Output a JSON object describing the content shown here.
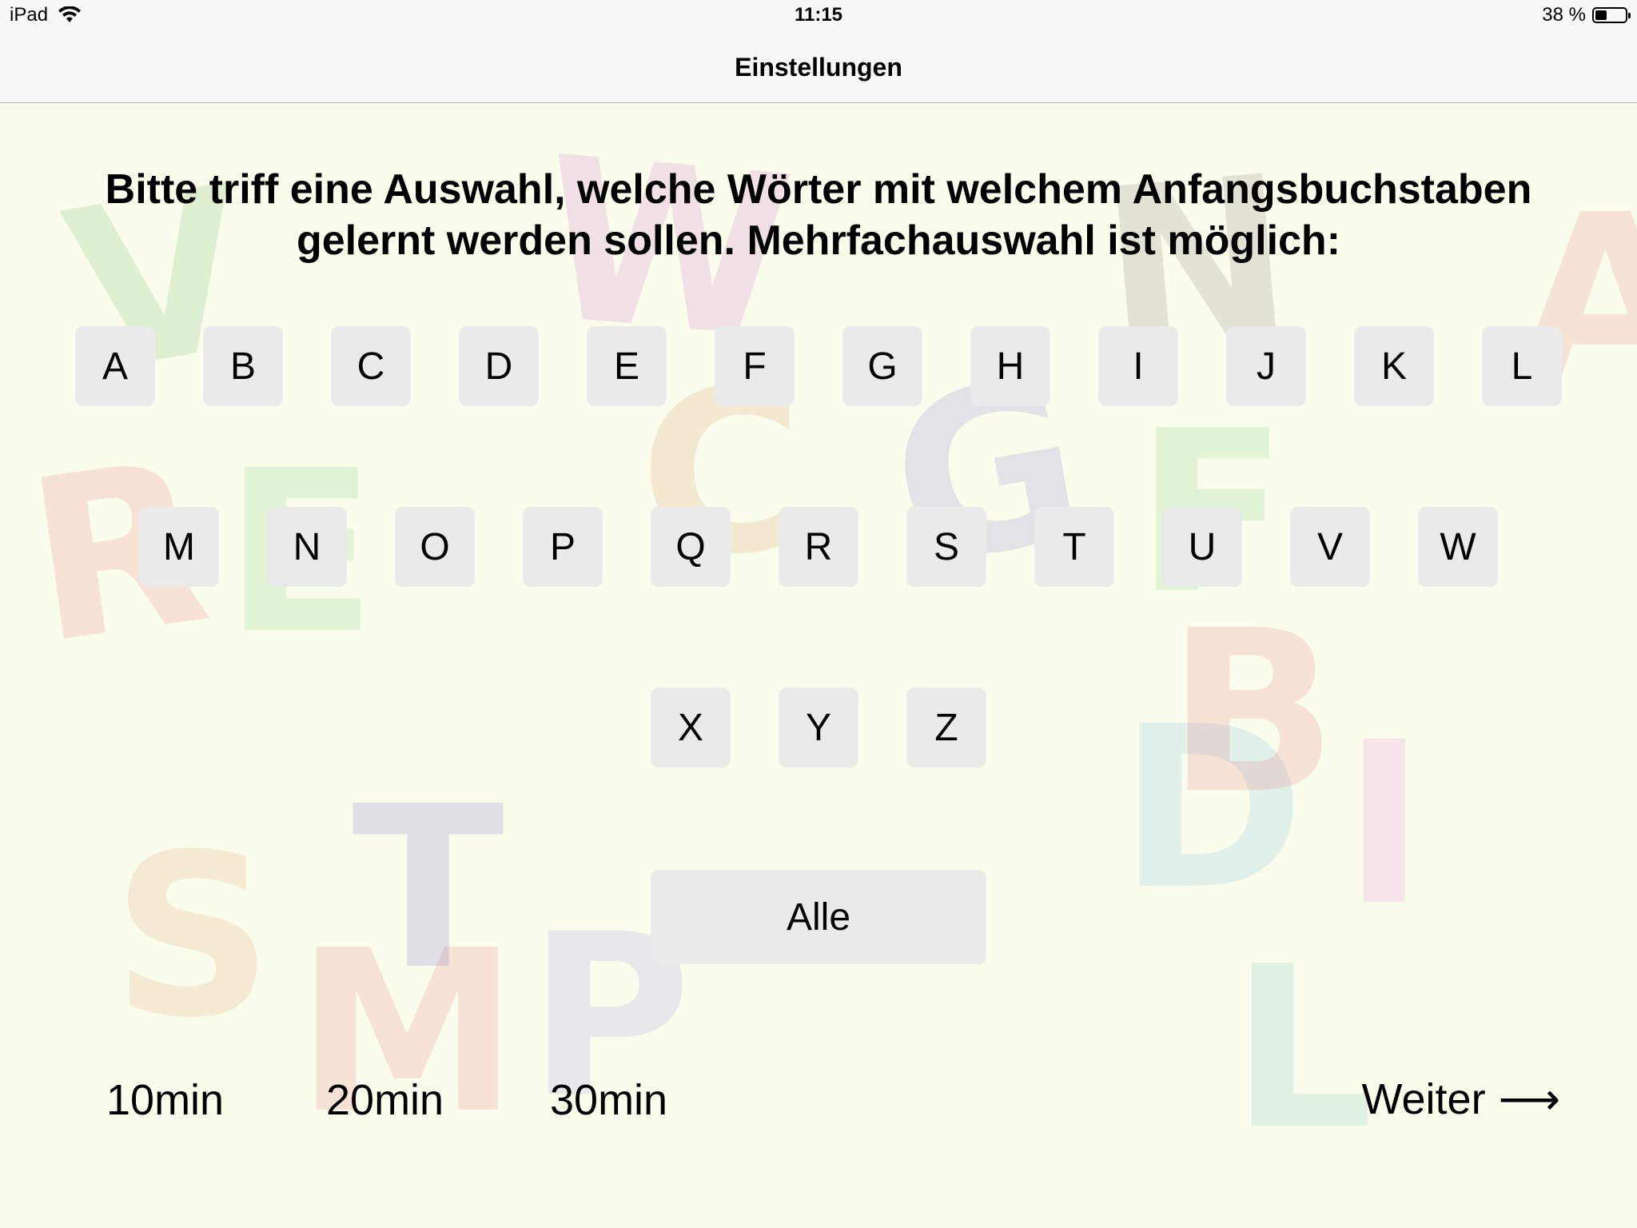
{
  "status_bar": {
    "device": "iPad",
    "time": "11:15",
    "battery_text": "38 %",
    "battery_level": 0.38
  },
  "nav": {
    "title": "Einstellungen"
  },
  "instruction": "Bitte triff eine Auswahl, welche Wörter mit welchem Anfangsbuchstaben gelernt werden sollen. Mehrfachauswahl ist möglich:",
  "letters_row1": [
    "A",
    "B",
    "C",
    "D",
    "E",
    "F",
    "G",
    "H",
    "I",
    "J",
    "K",
    "L"
  ],
  "letters_row2": [
    "M",
    "N",
    "O",
    "P",
    "Q",
    "R",
    "S",
    "T",
    "U",
    "V",
    "W"
  ],
  "letters_row3": [
    "X",
    "Y",
    "Z"
  ],
  "all_button": "Alle",
  "time_options": [
    "10min",
    "20min",
    "30min"
  ],
  "next_label": "Weiter",
  "next_arrow": "⟶",
  "background_letters": [
    "V",
    "W",
    "N",
    "A",
    "S",
    "R",
    "E",
    "C",
    "G",
    "F",
    "D",
    "B",
    "M",
    "P",
    "L",
    "I",
    "T"
  ]
}
